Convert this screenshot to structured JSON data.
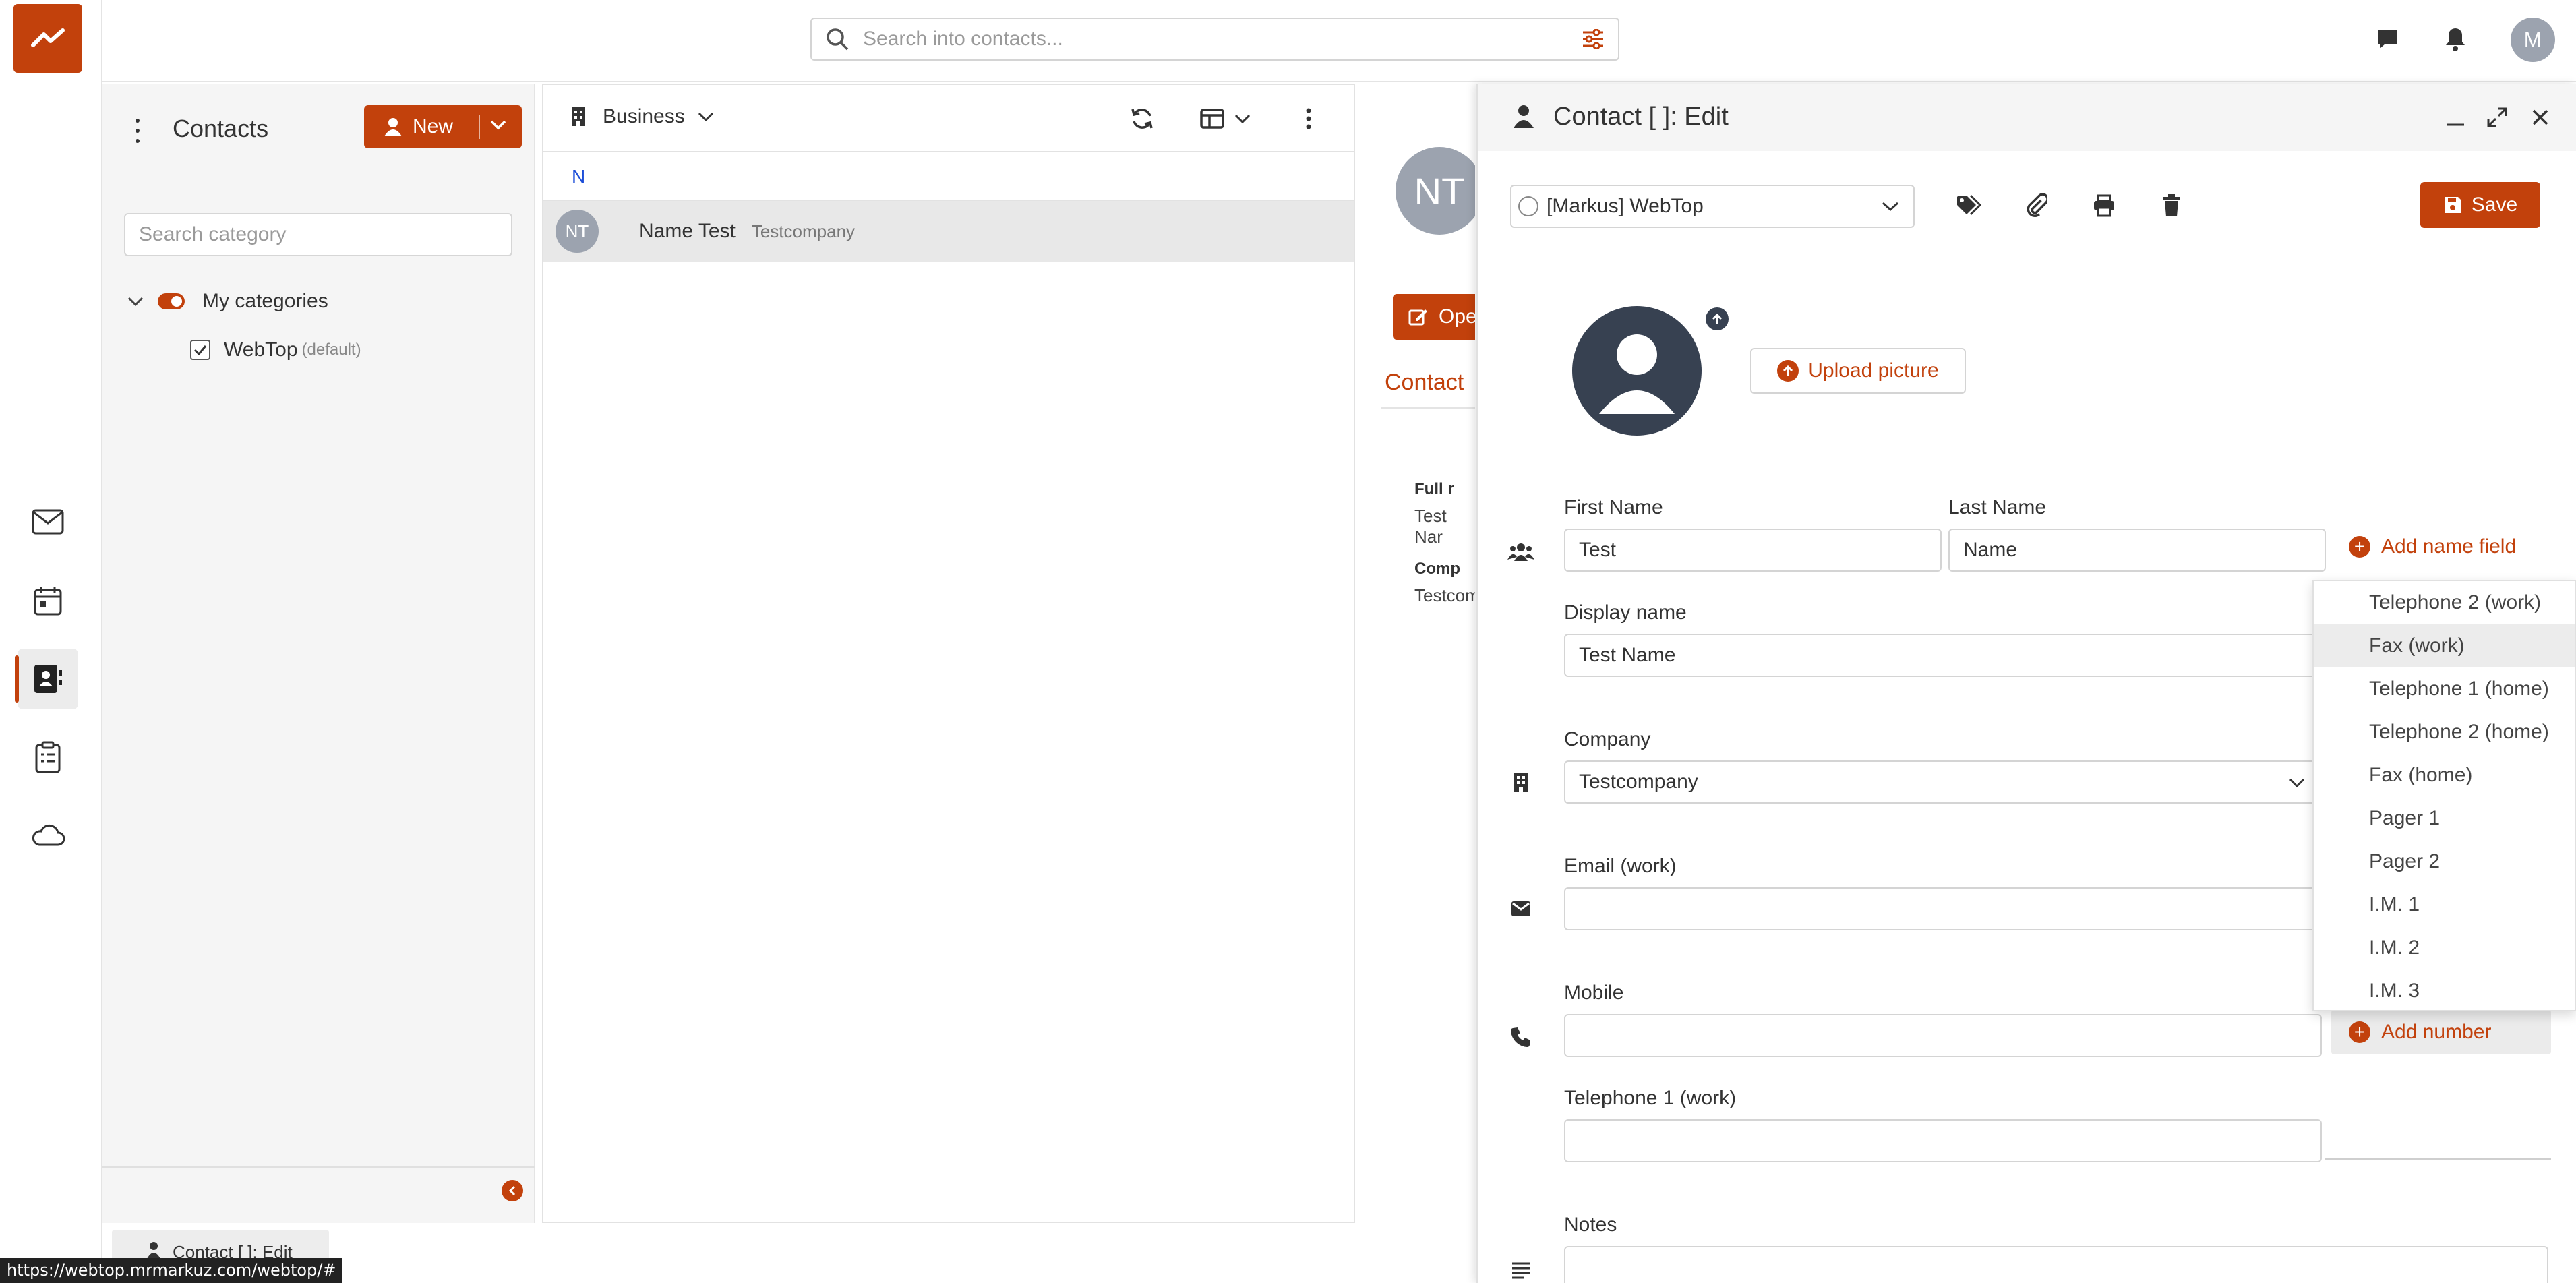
{
  "colors": {
    "accent": "#c2410c",
    "avatar_gray": "#9ca3af",
    "photo_dark": "#374151"
  },
  "header": {
    "search_placeholder": "Search into contacts...",
    "user_initial": "M"
  },
  "rail": {
    "items": [
      "mail-icon",
      "calendar-icon",
      "contacts-icon",
      "tasks-icon",
      "cloud-icon"
    ],
    "active": "contacts-icon"
  },
  "sidebar": {
    "title": "Contacts",
    "new_label": "New",
    "search_placeholder": "Search category",
    "group_label": "My categories",
    "category": {
      "name": "WebTop",
      "tag": "(default)",
      "checked": true
    }
  },
  "list": {
    "grouping": "Business",
    "letter": "N",
    "items": [
      {
        "initials": "NT",
        "name": "Name Test",
        "company": "Testcompany"
      }
    ]
  },
  "preview": {
    "initials": "NT",
    "open_label": "Ope",
    "tab_label": "Contact",
    "full_name_label": "Full r",
    "full_name_value": "Test Nar",
    "company_label": "Comp",
    "company_value": "Testcom"
  },
  "edit": {
    "title": "Contact [ ]: Edit",
    "calendar_value": "[Markus] WebTop",
    "save_label": "Save",
    "upload_label": "Upload picture",
    "first_name_label": "First Name",
    "first_name_value": "Test",
    "last_name_label": "Last Name",
    "last_name_value": "Name",
    "add_name_field": "Add name field",
    "display_name_label": "Display name",
    "display_name_value": "Test Name",
    "company_label": "Company",
    "company_value": "Testcompany",
    "email_label": "Email (work)",
    "email_value": "",
    "mobile_label": "Mobile",
    "mobile_value": "",
    "add_number": "Add number",
    "tel1_label": "Telephone 1 (work)",
    "tel1_value": "",
    "notes_label": "Notes"
  },
  "dropdown": {
    "items": [
      "Telephone 2 (work)",
      "Fax (work)",
      "Telephone 1 (home)",
      "Telephone 2 (home)",
      "Fax (home)",
      "Pager 1",
      "Pager 2",
      "I.M. 1",
      "I.M. 2",
      "I.M. 3"
    ],
    "highlighted": "Fax (work)"
  },
  "footer": {
    "taskbar_label": "Contact [ ]: Edit",
    "status_url": "https://webtop.mrmarkuz.com/webtop/#"
  }
}
